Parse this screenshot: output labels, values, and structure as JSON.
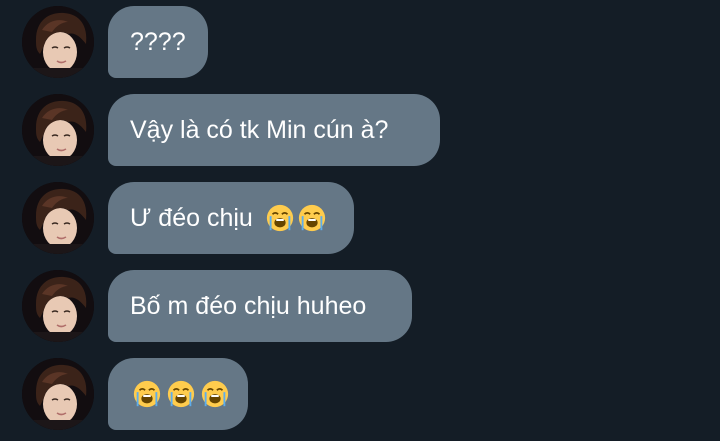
{
  "messages": [
    {
      "text": "????",
      "emojis": []
    },
    {
      "text": "Vậy là có tk Min cún à?",
      "emojis": []
    },
    {
      "text": "Ư đéo chịu",
      "emojis": [
        "loudly-crying-face",
        "loudly-crying-face"
      ]
    },
    {
      "text": "Bố m đéo chịu huheo",
      "emojis": []
    },
    {
      "text": "",
      "emojis": [
        "loudly-crying-face",
        "loudly-crying-face",
        "loudly-crying-face"
      ]
    }
  ],
  "colors": {
    "background": "#141d26",
    "bubble": "#657786",
    "text": "#ffffff"
  },
  "icons": {
    "avatar": "user-avatar-photo",
    "emoji": "loudly-crying-face-icon"
  }
}
